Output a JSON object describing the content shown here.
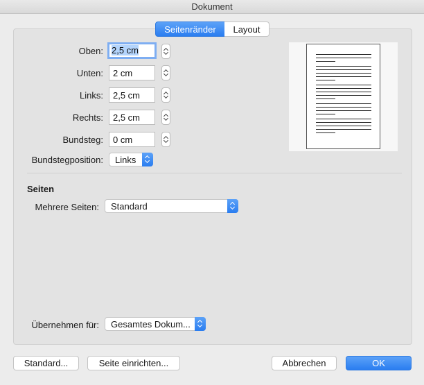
{
  "window": {
    "title": "Dokument"
  },
  "tabs": [
    {
      "label": "Seitenränder",
      "selected": true
    },
    {
      "label": "Layout",
      "selected": false
    }
  ],
  "margins": {
    "top": {
      "label": "Oben:",
      "value": "2,5 cm"
    },
    "bottom": {
      "label": "Unten:",
      "value": "2 cm"
    },
    "left": {
      "label": "Links:",
      "value": "2,5 cm"
    },
    "right": {
      "label": "Rechts:",
      "value": "2,5 cm"
    },
    "gutter": {
      "label": "Bundsteg:",
      "value": "0 cm"
    },
    "gutter_position": {
      "label": "Bundstegposition:",
      "value": "Links"
    }
  },
  "pages": {
    "heading": "Seiten",
    "multiple_label": "Mehrere Seiten:",
    "multiple_value": "Standard"
  },
  "apply": {
    "label": "Übernehmen für:",
    "value": "Gesamtes Dokum..."
  },
  "buttons": {
    "default": "Standard...",
    "page_setup": "Seite einrichten...",
    "cancel": "Abbrechen",
    "ok": "OK"
  },
  "colors": {
    "accent": "#2a7df0",
    "selection": "#b3d4fc"
  }
}
